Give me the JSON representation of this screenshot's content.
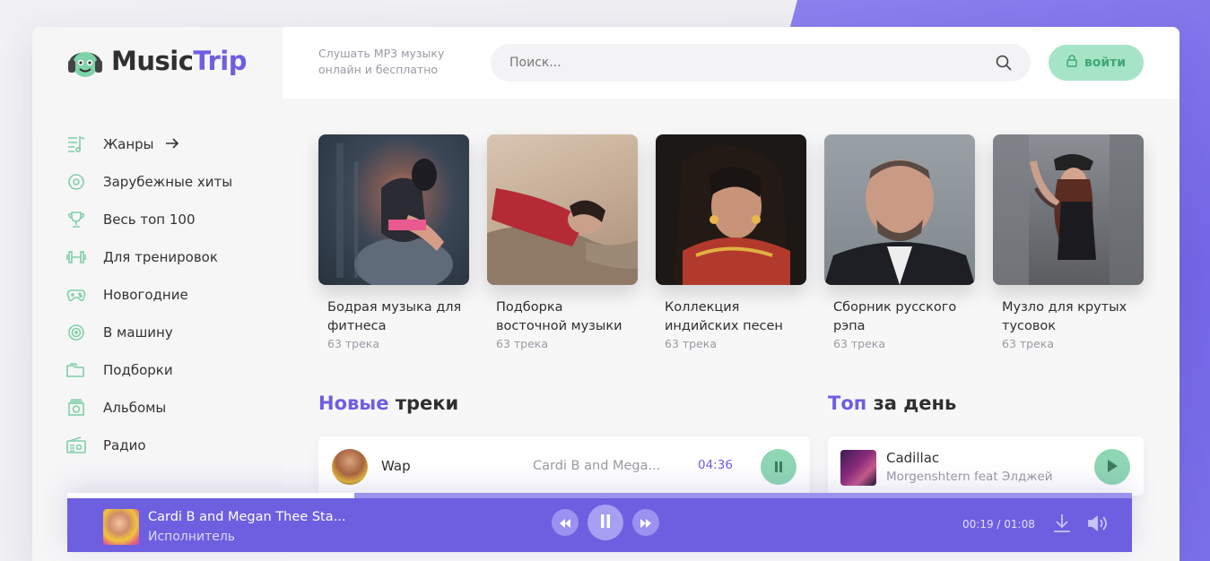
{
  "brand": {
    "name_part1": "Music",
    "name_part2": "Trip"
  },
  "header": {
    "tagline": "Слушать MP3 музыку онлайн и бесплатно",
    "search_placeholder": "Поиск...",
    "login_label": "войти"
  },
  "sidebar": {
    "items": [
      {
        "label": "Жанры",
        "icon": "genres-icon"
      },
      {
        "label": "Зарубежные хиты",
        "icon": "disc-icon"
      },
      {
        "label": "Весь топ 100",
        "icon": "trophy-icon"
      },
      {
        "label": "Для тренировок",
        "icon": "dumbbell-icon"
      },
      {
        "label": "Новогодние",
        "icon": "gamepad-icon"
      },
      {
        "label": "В машину",
        "icon": "wheel-icon"
      },
      {
        "label": "Подборки",
        "icon": "folder-icon"
      },
      {
        "label": "Альбомы",
        "icon": "album-icon"
      },
      {
        "label": "Радио",
        "icon": "radio-icon"
      }
    ]
  },
  "collections": [
    {
      "title": "Бодрая музыка для фитнеса",
      "count": "63 трека"
    },
    {
      "title": "Подборка восточной музыки",
      "count": "63 трека"
    },
    {
      "title": "Коллекция индийских песен",
      "count": "63 трека"
    },
    {
      "title": "Сборник русского рэпа",
      "count": "63 трека"
    },
    {
      "title": "Музло для крутых тусовок",
      "count": "63 трека"
    }
  ],
  "new_tracks": {
    "title_accent": "Новые",
    "title_rest": "треки",
    "items": [
      {
        "title": "Wap",
        "artist": "Cardi B and Mega...",
        "duration": "04:36"
      }
    ]
  },
  "top_day": {
    "title_accent": "Топ",
    "title_rest": "за день",
    "items": [
      {
        "title": "Cadillac",
        "artist": "Morgenshtern feat Элджей"
      }
    ]
  },
  "player": {
    "title": "Cardi B and Megan Thee Sta...",
    "subtitle": "Исполнитель",
    "time": "00:19 / 01:08",
    "progress": 0.27
  },
  "colors": {
    "accent": "#6e5ee2",
    "green": "#8ed6b4",
    "player_bg": "#6d5fe0"
  }
}
